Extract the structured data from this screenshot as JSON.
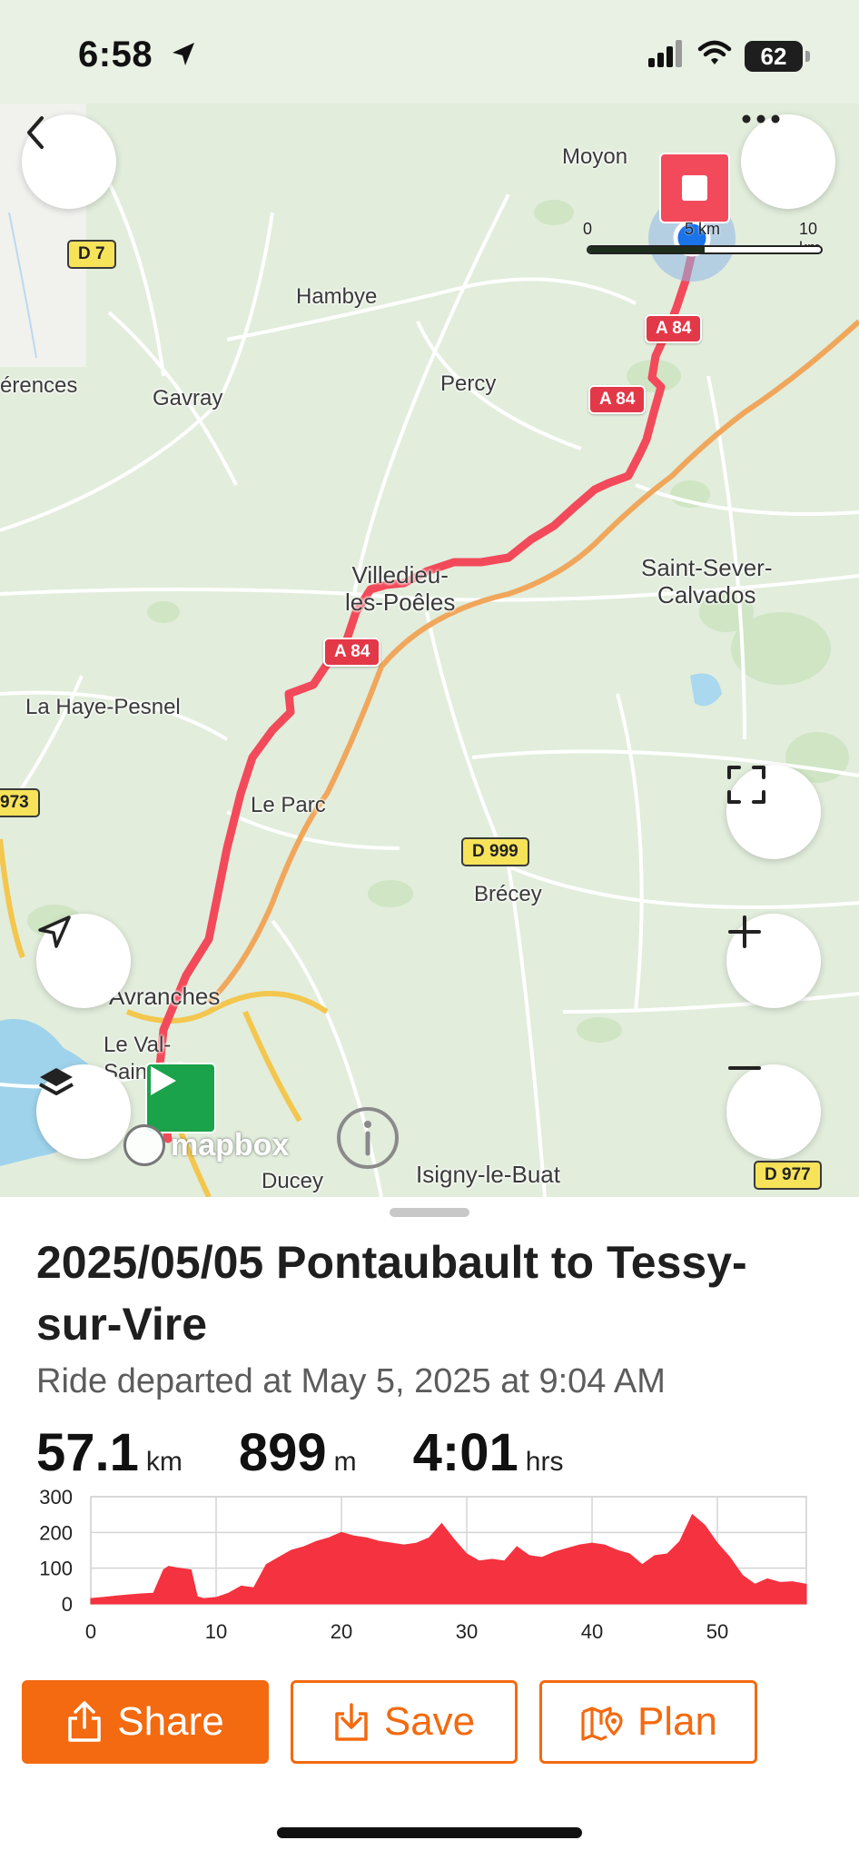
{
  "status_bar": {
    "time": "6:58",
    "battery": "62",
    "icons": [
      "location-arrow-icon",
      "cellular-signal-icon",
      "wifi-icon",
      "battery-icon"
    ]
  },
  "map": {
    "places": [
      {
        "id": "moyon",
        "label": "Moyon"
      },
      {
        "id": "hambye",
        "label": "Hambye"
      },
      {
        "id": "erences",
        "label": "érences"
      },
      {
        "id": "gavray",
        "label": "Gavray"
      },
      {
        "id": "percy",
        "label": "Percy"
      },
      {
        "id": "villedieu",
        "label": "Villedieu-\nles-Poêles"
      },
      {
        "id": "saint-sever",
        "label": "Saint-Sever-\nCalvados"
      },
      {
        "id": "la-haye-pesnel",
        "label": "La Haye-Pesnel"
      },
      {
        "id": "le-parc",
        "label": "Le Parc"
      },
      {
        "id": "brecey",
        "label": "Brécey"
      },
      {
        "id": "avranches",
        "label": "Avranches"
      },
      {
        "id": "le-val-saint-pere",
        "label": "Le Val-\nSaint-Père"
      },
      {
        "id": "ducey",
        "label": "Ducey"
      },
      {
        "id": "isigny",
        "label": "Isigny-le-Buat"
      }
    ],
    "road_labels": {
      "a84_1": "A 84",
      "a84_2": "A 84",
      "a84_3": "A 84",
      "d7": "D 7",
      "d973": "973",
      "d999": "D 999",
      "d977": "D 977"
    },
    "scale": {
      "zero": "0",
      "mid": "5 km",
      "end": "10 km"
    },
    "attribution": "mapbox",
    "route_color": "#f24a5a"
  },
  "ride": {
    "title": "2025/05/05 Pontaubault to Tessy-sur-Vire",
    "subtitle": "Ride departed at May 5, 2025 at 9:04 AM",
    "distance": {
      "value": "57.1",
      "unit": "km"
    },
    "elevation_gain": {
      "value": "899",
      "unit": "m"
    },
    "duration": {
      "value": "4:01",
      "unit": "hrs"
    }
  },
  "chart_data": {
    "type": "area",
    "xlim": [
      0,
      57.1
    ],
    "ylim": [
      0,
      300
    ],
    "xticks": [
      0,
      10,
      20,
      30,
      40,
      50
    ],
    "yticks": [
      0,
      100,
      200,
      300
    ],
    "grid": true,
    "color": "#f5323f",
    "series": [
      {
        "x": [
          0,
          1,
          2,
          3,
          4,
          5,
          5.8,
          6.2,
          7,
          8,
          8.5,
          9,
          10,
          11,
          12,
          13,
          14,
          15,
          16,
          17,
          18,
          19,
          20,
          21,
          22,
          23,
          24,
          25,
          26,
          27,
          28,
          29,
          30,
          31,
          32,
          33,
          34,
          35,
          36,
          37,
          38,
          39,
          40,
          41,
          42,
          43,
          44,
          45,
          46,
          47,
          48,
          49,
          50,
          51,
          52,
          53,
          54,
          55,
          56,
          57.1
        ],
        "y": [
          15,
          18,
          22,
          25,
          28,
          30,
          95,
          105,
          100,
          95,
          20,
          15,
          18,
          30,
          50,
          45,
          110,
          130,
          150,
          160,
          175,
          185,
          200,
          190,
          185,
          175,
          170,
          165,
          170,
          185,
          225,
          180,
          140,
          120,
          125,
          120,
          160,
          135,
          130,
          145,
          155,
          165,
          170,
          165,
          150,
          140,
          110,
          135,
          140,
          175,
          250,
          220,
          170,
          130,
          80,
          55,
          70,
          60,
          62,
          55
        ]
      }
    ]
  },
  "actions": {
    "share": "Share",
    "save": "Save",
    "plan": "Plan"
  }
}
